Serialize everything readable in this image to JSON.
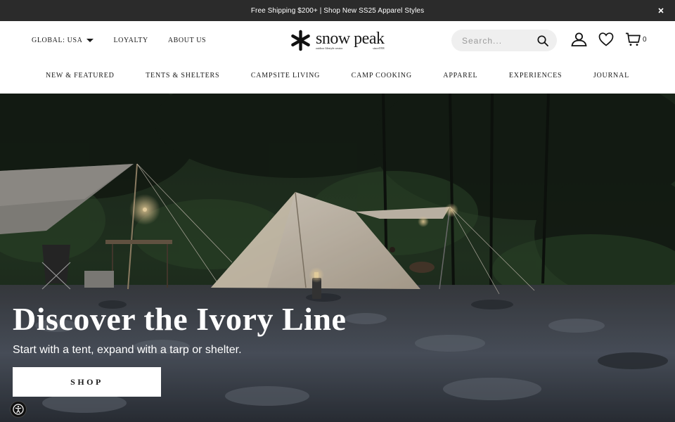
{
  "announcement": {
    "text": "Free Shipping $200+ | Shop New SS25 Apparel Styles",
    "close_icon": "close-icon"
  },
  "header": {
    "utility_links": [
      {
        "label": "GLOBAL: USA"
      },
      {
        "label": "LOYALTY"
      },
      {
        "label": "ABOUT US"
      }
    ],
    "logo": {
      "word": "snow peak",
      "tagline": "outdoor lifestyle creator",
      "since": "since1958"
    },
    "search": {
      "placeholder": "Search..."
    },
    "cart": {
      "count": "0"
    },
    "icons": [
      "search-icon",
      "account-icon",
      "wishlist-heart-icon",
      "cart-icon"
    ]
  },
  "nav": {
    "items": [
      {
        "label": "NEW & FEATURED"
      },
      {
        "label": "TENTS & SHELTERS"
      },
      {
        "label": "CAMPSITE LIVING"
      },
      {
        "label": "CAMP COOKING"
      },
      {
        "label": "APPAREL"
      },
      {
        "label": "EXPERIENCES"
      },
      {
        "label": "JOURNAL"
      }
    ]
  },
  "hero": {
    "title": "Discover the Ivory Line",
    "subtitle": "Start with a tent, expand with a tarp or shelter.",
    "cta_label": "SHOP"
  },
  "colors": {
    "announcement_bg": "#2b2b2b",
    "search_bg": "#efefef",
    "text": "#1a1a1a",
    "button_bg": "#ffffff"
  }
}
